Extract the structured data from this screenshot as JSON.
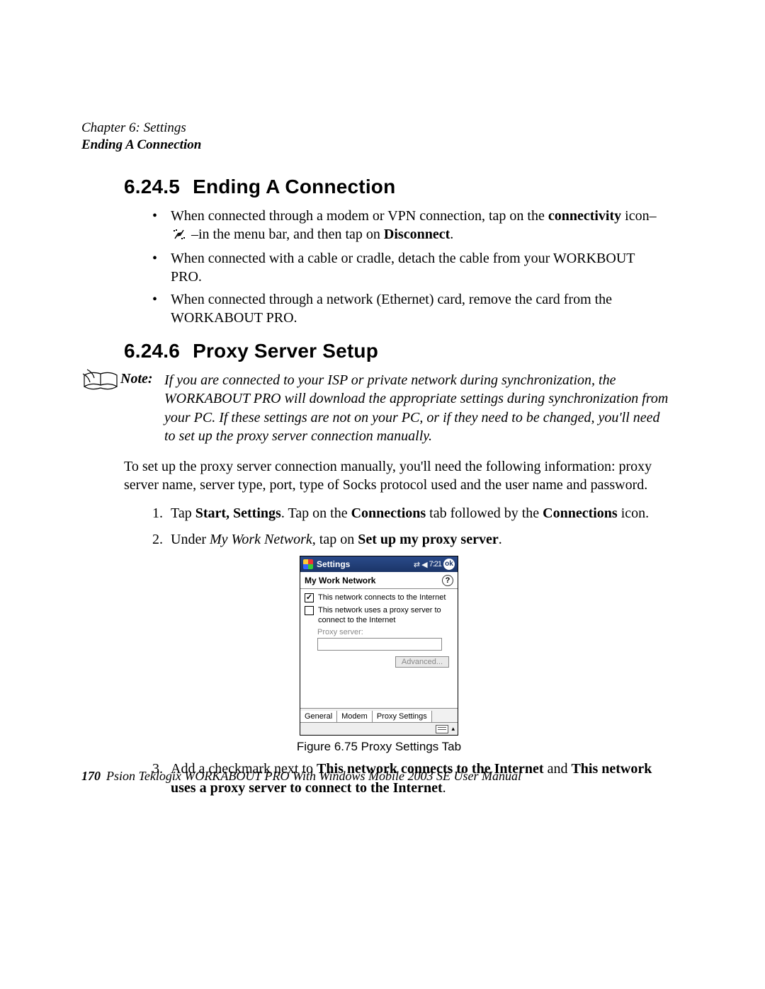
{
  "header": {
    "chapter_line": "Chapter 6: Settings",
    "section_sub": "Ending A Connection"
  },
  "h1": {
    "num": "6.24.5",
    "title": "Ending A Connection"
  },
  "bullets": {
    "b1_pre": "When connected through a modem or VPN connection, tap on the ",
    "b1_bold1": "connectivity",
    "b1_mid1": " icon– ",
    "b1_mid2": " –in the menu bar, and then tap on ",
    "b1_bold2": "Disconnect",
    "b1_end": ".",
    "b2": "When connected with a cable or cradle, detach the cable from your WORKBOUT PRO.",
    "b3": "When connected through a network (Ethernet) card, remove the card from the WORKABOUT PRO."
  },
  "h2": {
    "num": "6.24.6",
    "title": "Proxy Server Setup"
  },
  "note": {
    "label": "Note:",
    "text": "If you are connected to your ISP or private network during synchronization, the WORKABOUT PRO will download the appropriate settings during synchronization from your PC. If these settings are not on your PC, or if they need to be changed, you'll need to set up the proxy server connection manually."
  },
  "para1": "To set up the proxy server connection manually, you'll need the following information: proxy server name, server type, port, type of Socks protocol used and the user name and password.",
  "steps": {
    "s1_pre": "Tap ",
    "s1_b1": "Start, Settings",
    "s1_mid1": ". Tap on the ",
    "s1_b2": "Connections",
    "s1_mid2": " tab followed by the ",
    "s1_b3": "Connections",
    "s1_end": " icon.",
    "s2_pre": "Under ",
    "s2_i1": "My Work Network",
    "s2_mid": ", tap on ",
    "s2_b1": "Set up my proxy server",
    "s2_end": "."
  },
  "device": {
    "titlebar": "Settings",
    "time": "7:21",
    "ok": "ok",
    "header2": "My Work Network",
    "chk1": "This network connects to the Internet",
    "chk2": "This network uses a proxy server to connect to the Internet",
    "proxy_label": "Proxy server:",
    "advanced": "Advanced...",
    "tabs": [
      "General",
      "Modem",
      "Proxy Settings"
    ]
  },
  "figure_caption": "Figure 6.75 Proxy Settings Tab",
  "step3": {
    "pre": "Add a checkmark next to ",
    "b1": "This network connects to the Internet",
    "mid": " and ",
    "b2": "This network uses a proxy server to connect to the Internet",
    "end": "."
  },
  "footer": {
    "page": "170",
    "text": "Psion Teklogix WORKABOUT PRO With Windows Mobile 2003 SE User Manual"
  }
}
